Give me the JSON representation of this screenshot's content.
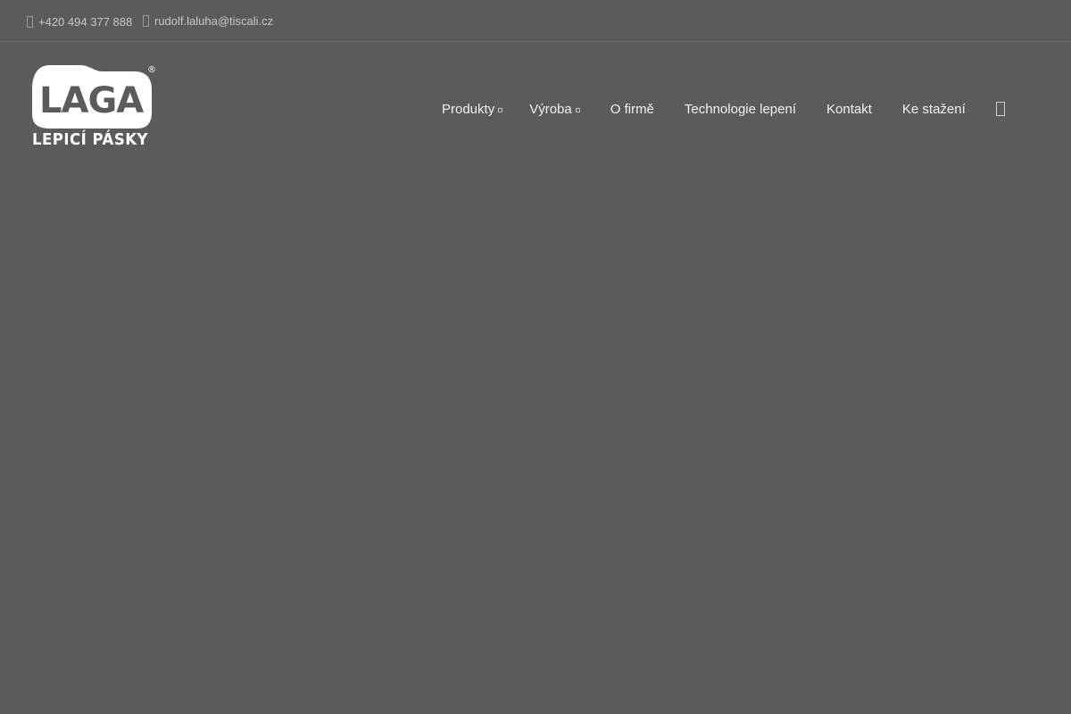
{
  "topbar": {
    "phone": "+420 494 377 888",
    "email": "rudolf.laluha@tiscali.cz"
  },
  "logo": {
    "wordmark": "LAGA",
    "tagline": "LEPICÍ PÁSKY",
    "registered": "®"
  },
  "nav": {
    "items": [
      {
        "label": "Produkty",
        "has_dropdown": true
      },
      {
        "label": "Výroba",
        "has_dropdown": true
      },
      {
        "label": "O firmě",
        "has_dropdown": false
      },
      {
        "label": "Technologie lepení",
        "has_dropdown": false
      },
      {
        "label": "Kontakt",
        "has_dropdown": false
      },
      {
        "label": "Ke stažení",
        "has_dropdown": false
      }
    ],
    "search_icon": "search-icon"
  },
  "colors": {
    "background": "#5b5b5b",
    "text": "#f2f2f2",
    "muted": "#c8c8c8"
  }
}
